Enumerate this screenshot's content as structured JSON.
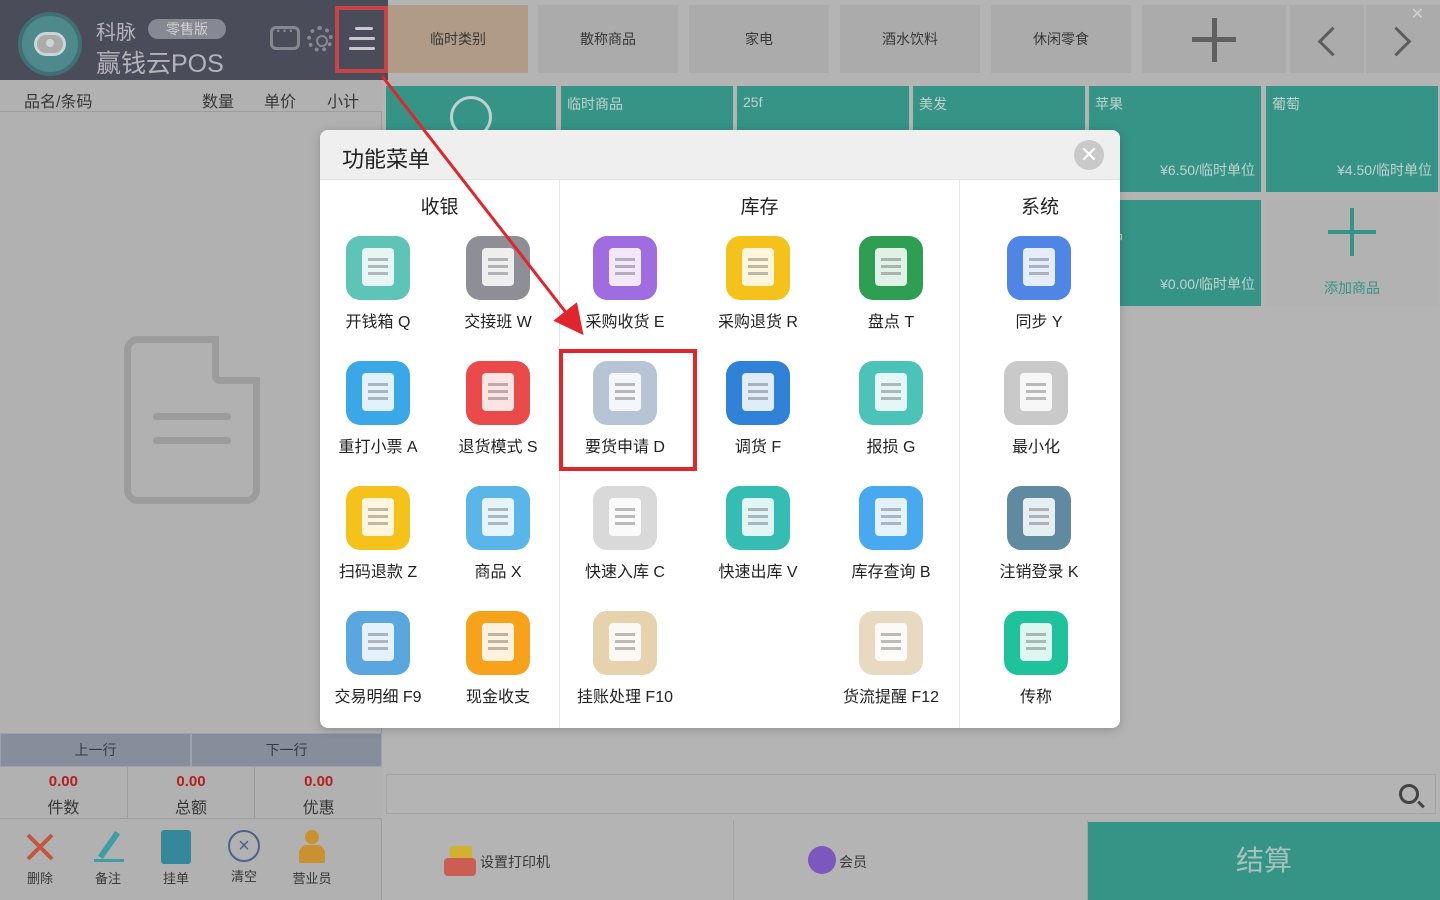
{
  "header": {
    "brand_line1": "科脉",
    "edition": "零售版",
    "brand_line2": "赢钱云POS"
  },
  "cart": {
    "columns": [
      "品名/条码",
      "数量",
      "单价",
      "小计"
    ],
    "prev_row": "上一行",
    "next_row": "下一行",
    "totals": [
      {
        "value": "0.00",
        "label": "件数"
      },
      {
        "value": "0.00",
        "label": "总额"
      },
      {
        "value": "0.00",
        "label": "优惠"
      }
    ],
    "tools": [
      {
        "label": "删除",
        "icon": "delete-icon"
      },
      {
        "label": "备注",
        "icon": "note-icon"
      },
      {
        "label": "挂单",
        "icon": "hold-order-icon"
      },
      {
        "label": "清空",
        "icon": "clear-icon"
      },
      {
        "label": "营业员",
        "icon": "staff-icon"
      }
    ]
  },
  "categories": [
    "临时类别",
    "散称商品",
    "家电",
    "酒水饮料",
    "休闲零食"
  ],
  "products": [
    {
      "name": "临时商品"
    },
    {
      "name": "25f"
    },
    {
      "name": "美发"
    },
    {
      "name": "苹果",
      "price": "¥6.50/临时单位"
    },
    {
      "name": "葡萄",
      "price": "¥4.50/临时单位"
    },
    {
      "name": "商品",
      "price": "¥0.00/临时单位"
    }
  ],
  "add_product_label": "添加商品",
  "bottom": {
    "printer": "设置打印机",
    "member": "会员",
    "checkout": "结算"
  },
  "menu": {
    "title": "功能菜单",
    "sections": [
      "收银",
      "库存",
      "系统"
    ],
    "items": [
      {
        "label": "开钱箱 Q",
        "color": "#5fc4b8"
      },
      {
        "label": "交接班 W",
        "color": "#8e8e96"
      },
      {
        "label": "采购收货 E",
        "color": "#a06de0"
      },
      {
        "label": "采购退货 R",
        "color": "#f4c21a"
      },
      {
        "label": "盘点 T",
        "color": "#2e9e52"
      },
      {
        "label": "同步 Y",
        "color": "#4f86e6"
      },
      {
        "label": "重打小票 A",
        "color": "#3aa8e6"
      },
      {
        "label": "退货模式 S",
        "color": "#ea4a4a"
      },
      {
        "label": "要货申请 D",
        "color": "#b7c4d6"
      },
      {
        "label": "调货 F",
        "color": "#2f82d8"
      },
      {
        "label": "报损 G",
        "color": "#4cc3b9"
      },
      {
        "label": "最小化",
        "color": "#c9c9c9"
      },
      {
        "label": "扫码退款 Z",
        "color": "#f4c21a"
      },
      {
        "label": "商品 X",
        "color": "#5ab6e8"
      },
      {
        "label": "快速入库 C",
        "color": "#d9d9d9"
      },
      {
        "label": "快速出库 V",
        "color": "#35bdb4"
      },
      {
        "label": "库存查询 B",
        "color": "#48a8f0"
      },
      {
        "label": "注销登录 K",
        "color": "#5f8aa0"
      },
      {
        "label": "交易明细 F9",
        "color": "#5aa7e0"
      },
      {
        "label": "现金收支",
        "color": "#f7a21b"
      },
      {
        "label": "挂账处理 F10",
        "color": "#e6d2ad"
      },
      {
        "label": "货流提醒 F12",
        "color": "#e9d9c0"
      },
      {
        "label": "传称",
        "color": "#1fc29a"
      }
    ]
  }
}
